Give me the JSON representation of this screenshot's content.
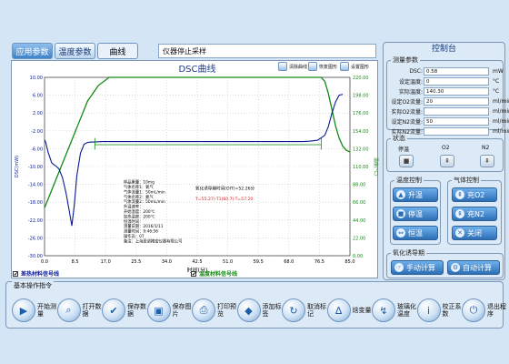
{
  "tabs": [
    {
      "label": "应用参数"
    },
    {
      "label": "温度参数"
    },
    {
      "label": "曲线"
    }
  ],
  "status_text": "仪器停止采样",
  "toolbar": [
    {
      "label": "清除曲线"
    },
    {
      "label": "恢复图形"
    },
    {
      "label": "设置图形"
    }
  ],
  "checks": [
    {
      "label": "差热材料信号线"
    },
    {
      "label": "温度材料信号线"
    }
  ],
  "console": {
    "title": "控制台",
    "params_legend": "测量参数",
    "params": [
      {
        "label": "DSC:",
        "value": "0.58",
        "unit": "mW"
      },
      {
        "label": "设定温度:",
        "value": "0",
        "unit": "°C"
      },
      {
        "label": "实际温度:",
        "value": "140.30",
        "unit": "°C"
      },
      {
        "label": "设定O2流量:",
        "value": "20",
        "unit": "ml/min"
      },
      {
        "label": "实际O2流量:",
        "value": "",
        "unit": "ml/min"
      },
      {
        "label": "设定N2流量:",
        "value": "50",
        "unit": "ml/min"
      },
      {
        "label": "实际N2流量:",
        "value": "",
        "unit": "ml/min"
      }
    ],
    "state_legend": "状态",
    "state_labels": [
      "停温",
      "O2",
      "N2"
    ],
    "temp_legend": "温度控制",
    "temp_buttons": [
      "升温",
      "停温",
      "恒温"
    ],
    "gas_legend": "气体控制",
    "gas_buttons": [
      "充O2",
      "充N2",
      "关闭"
    ],
    "oit_legend": "氧化诱导期",
    "oit_buttons": [
      "手动计算",
      "自动计算"
    ]
  },
  "bottom": {
    "title": "基本操作指令",
    "buttons": [
      {
        "label": "开始测量",
        "icon": "play-icon"
      },
      {
        "label": "打开数据",
        "icon": "search-icon"
      },
      {
        "label": "保存数据",
        "icon": "check-icon"
      },
      {
        "label": "保存图片",
        "icon": "image-icon"
      },
      {
        "label": "打印预览",
        "icon": "printer-icon"
      },
      {
        "label": "添加标签",
        "icon": "tag-icon"
      },
      {
        "label": "取消标记",
        "icon": "refresh-icon"
      },
      {
        "label": "焓变量",
        "icon": "enthalpy-icon"
      },
      {
        "label": "玻璃化温度",
        "icon": "glass-transition-icon"
      },
      {
        "label": "校正系数",
        "icon": "info-icon"
      },
      {
        "label": "退出程序",
        "icon": "power-icon"
      }
    ]
  },
  "chart_data": {
    "type": "line",
    "title": "DSC曲线",
    "xlabel": "时间(分)",
    "ylabel": "DSC(mW)",
    "y2label": "温度(°C)",
    "xlim": [
      0,
      85
    ],
    "ylim": [
      -30,
      10
    ],
    "y2lim": [
      0,
      220
    ],
    "x_ticks": [
      "0.0",
      "8.5",
      "17.0",
      "25.5",
      "34.0",
      "42.5",
      "51.0",
      "59.5",
      "68.0",
      "76.5",
      "85.0"
    ],
    "y_ticks": [
      "10.00",
      "6.00",
      "2.00",
      "-2.00",
      "-6.00",
      "-10.00",
      "-14.00",
      "-18.00",
      "-22.00",
      "-26.00",
      "-30.00"
    ],
    "y2_ticks": [
      "220.00",
      "198.00",
      "176.00",
      "154.00",
      "132.00",
      "110.00",
      "88.00",
      "66.00",
      "44.00",
      "22.00",
      "0.00"
    ],
    "series": [
      {
        "color": "#0a1a96",
        "x": [
          0,
          0.3,
          1,
          2,
          3,
          4,
          5,
          6,
          7,
          7.6,
          8.3,
          9,
          10,
          11,
          12,
          13,
          14,
          16,
          18,
          20,
          25,
          30,
          40,
          50,
          60,
          65,
          70,
          72,
          74,
          76,
          78,
          79,
          80,
          81,
          82,
          83
        ],
        "y": [
          -4,
          -4.5,
          -6.8,
          -9.2,
          -9.8,
          -10.5,
          -12.5,
          -16,
          -20.5,
          -23.3,
          -18.5,
          -12,
          -7,
          -5,
          -4.6,
          -4.5,
          -4.5,
          -4.4,
          -4.4,
          -4.4,
          -4.4,
          -4.4,
          -4.4,
          -4.4,
          -4.4,
          -4.4,
          -4.4,
          -4.4,
          -4.3,
          -4.1,
          -3,
          -1,
          2,
          4.5,
          6,
          6.2
        ]
      },
      {
        "color": "#138a13",
        "x": [
          0,
          2,
          4,
          6,
          8,
          10,
          12,
          15,
          18,
          19,
          20,
          30,
          40,
          50,
          60,
          70,
          77,
          78,
          79,
          80,
          81,
          82,
          83,
          84,
          85
        ],
        "y": [
          59,
          81,
          103,
          125,
          147,
          169,
          191,
          210,
          220,
          220,
          220,
          220,
          220,
          220,
          220,
          220,
          220,
          215,
          200,
          180,
          160,
          145,
          135,
          130,
          128
        ]
      }
    ],
    "annotations": {
      "sample_lines": [
        "样品重量：10mg",
        "气体名称1：氧气",
        "气体流量1：50mL/min",
        "气体名称2：氮气",
        "气体流量2：50mL/min",
        "升温速率：",
        "开始温度：200℃",
        "加热温度：200℃",
        "恒温时间：",
        "测量日期：2016/1/11",
        "测量时间：9:46:56",
        "操作员：07",
        "备注：上海盈诺精密仪器有限公司"
      ],
      "oit_label": "氧化诱导期时间(OIT)=52.26分",
      "oit_formula": "T=55.27)-T1(60.7)-T=57.20"
    }
  }
}
